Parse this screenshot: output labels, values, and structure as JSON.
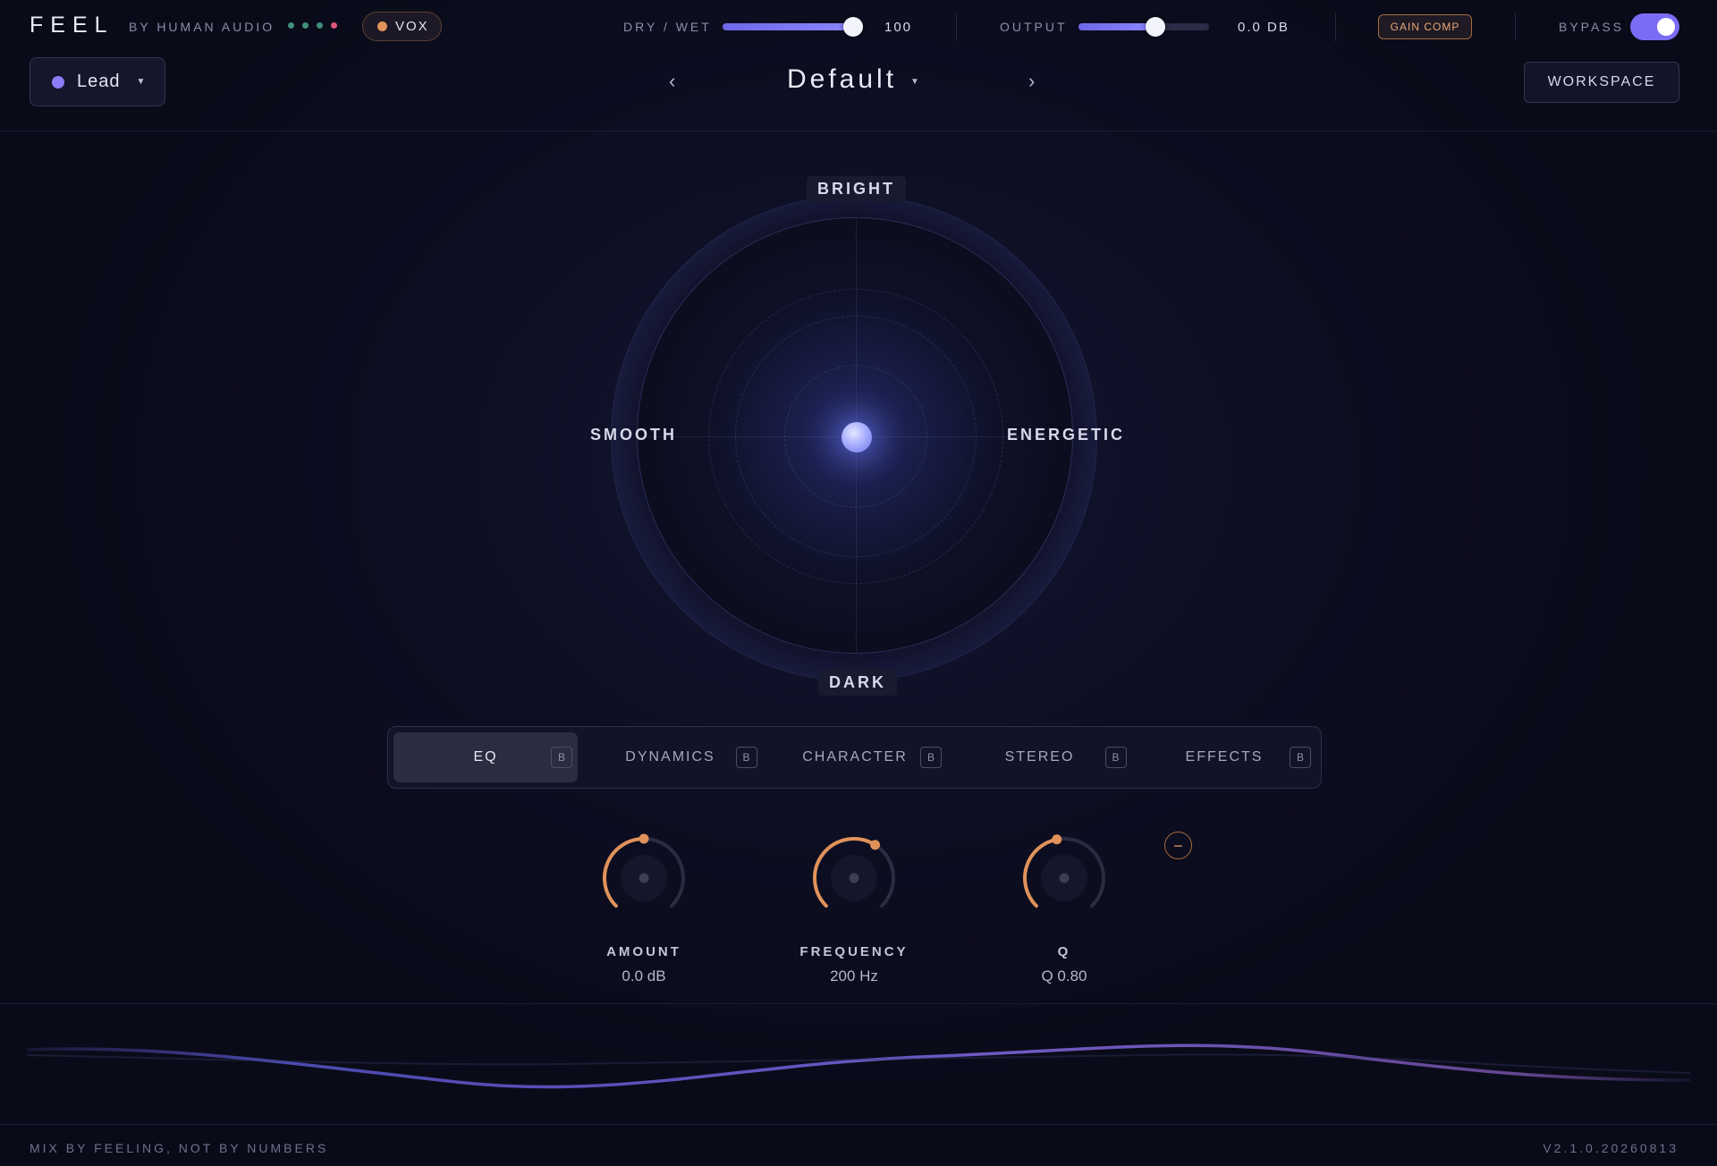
{
  "header": {
    "brand": "FEEL",
    "byline": "BY HUMAN AUDIO",
    "status_dots": [
      "#3f8f7a",
      "#3f8f7a",
      "#3f8f7a",
      "#e0567a"
    ],
    "vox": {
      "label": "VOX",
      "dot_color": "#e0925a"
    },
    "dry_wet": {
      "label": "DRY / WET",
      "value": "100",
      "fraction": 1.0
    },
    "output": {
      "label": "OUTPUT",
      "value": "0.0 DB",
      "fraction": 0.5
    },
    "gain_comp_label": "GAIN COMP",
    "bypass": {
      "label": "BYPASS",
      "on": true
    }
  },
  "track": {
    "label": "Lead",
    "dot_color": "#8b7cf8"
  },
  "preset": {
    "prev_icon": "‹",
    "name": "Default",
    "next_icon": "›"
  },
  "workspace_label": "WORKSPACE",
  "pad": {
    "top_label": "BRIGHT",
    "bottom_label": "DARK",
    "left_label": "SMOOTH",
    "right_label": "ENERGETIC",
    "puck": {
      "x": 0.0,
      "y": 0.0
    }
  },
  "tabs": [
    {
      "label": "EQ",
      "badge": "B",
      "active": true
    },
    {
      "label": "DYNAMICS",
      "badge": "B",
      "active": false
    },
    {
      "label": "CHARACTER",
      "badge": "B",
      "active": false
    },
    {
      "label": "STEREO",
      "badge": "B",
      "active": false
    },
    {
      "label": "EFFECTS",
      "badge": "B",
      "active": false
    }
  ],
  "knobs": [
    {
      "name": "AMOUNT",
      "value": "0.0 dB",
      "fraction": 0.5
    },
    {
      "name": "FREQUENCY",
      "value": "200 Hz",
      "fraction": 0.62
    },
    {
      "name": "Q",
      "value": "Q 0.80",
      "fraction": 0.46
    }
  ],
  "remove_band_icon": "−",
  "colors": {
    "accent": "#7a6cf5",
    "knob": "#e0925a",
    "wave": "#6b5fd8"
  },
  "footer": {
    "tagline": "MIX BY FEELING, NOT BY NUMBERS",
    "version": "V2.1.0.20260813"
  }
}
